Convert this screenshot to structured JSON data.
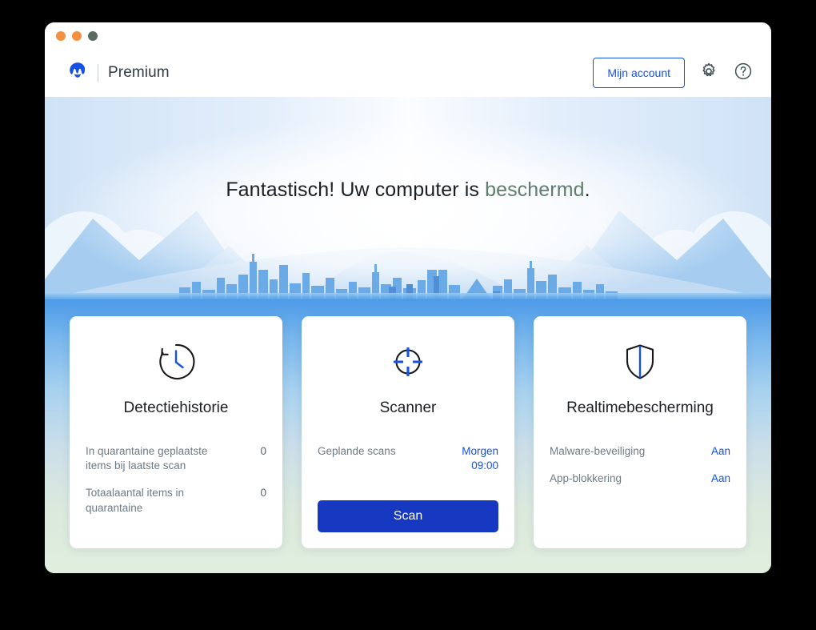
{
  "window": {
    "traffic_lights": [
      {
        "name": "close",
        "color": "#f4903f"
      },
      {
        "name": "minimize",
        "color": "#f4903f"
      },
      {
        "name": "zoom",
        "color": "#5c6b60"
      }
    ]
  },
  "header": {
    "logo_icon": "malwarebytes-logo-icon",
    "product_name": "Premium",
    "account_button_label": "Mijn account",
    "settings_icon": "gear-icon",
    "help_icon": "help-circle-icon",
    "accent_color": "#1452e6"
  },
  "hero": {
    "title_prefix": "Fantastisch! Uw computer is ",
    "status_word": "beschermd",
    "title_suffix": ".",
    "status_color": "#5f7d6c",
    "illustration": "city-skyline-mountains-clouds"
  },
  "cards": [
    {
      "id": "detection-history",
      "icon": "clock-history-icon",
      "title": "Detectiehistorie",
      "rows": [
        {
          "label": "In quarantaine geplaatste items bij laatste scan",
          "value": "0",
          "accent": false
        },
        {
          "label": "Totaalaantal items in quarantaine",
          "value": "0",
          "accent": false
        }
      ]
    },
    {
      "id": "scanner",
      "icon": "crosshair-target-icon",
      "title": "Scanner",
      "rows": [
        {
          "label": "Geplande scans",
          "value": "Morgen 09:00",
          "accent": true
        }
      ],
      "button_label": "Scan",
      "button_color": "#1739c2"
    },
    {
      "id": "realtime-protection",
      "icon": "shield-icon",
      "title": "Realtimebescherming",
      "rows": [
        {
          "label": "Malware-beveiliging",
          "value": "Aan",
          "accent": true
        },
        {
          "label": "App-blokkering",
          "value": "Aan",
          "accent": true
        }
      ]
    }
  ]
}
